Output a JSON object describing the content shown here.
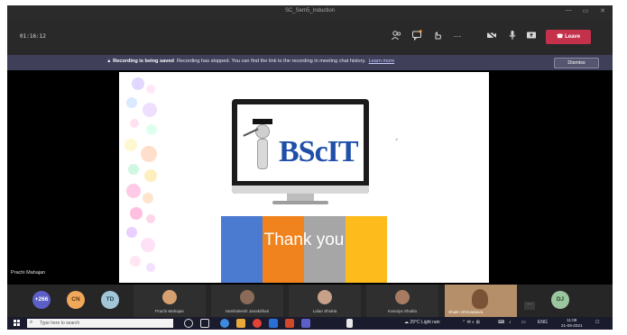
{
  "window": {
    "title": "SC_Sem5_Induction"
  },
  "toolbar": {
    "timer": "01:16:12",
    "icons": [
      "people-icon",
      "chat-icon",
      "reactions-icon",
      "more-icon",
      "camera-icon",
      "mic-icon",
      "share-icon"
    ],
    "leave_label": "Leave",
    "leave_color": "#c4314b"
  },
  "banner": {
    "bold": "Recording is being saved",
    "text": "Recording has stopped. You can find the link to the recording in meeting chat history.",
    "link": "Learn more",
    "dismiss": "Dismiss"
  },
  "stage": {
    "presenter_name": "Prachi Mahajan"
  },
  "slide": {
    "logo_text": "BScIT",
    "thank_you": "Thank you",
    "strip_colors": [
      "#4a7bd0",
      "#f0831e",
      "#a6a6a6",
      "#fdbb1c"
    ]
  },
  "gallery": {
    "overflow": "+266",
    "initials": [
      {
        "text": "CN",
        "color": "#f0a85a"
      },
      {
        "text": "TD",
        "color": "#a2c6d8"
      },
      {
        "text": "DJ",
        "color": "#9cc6a0"
      }
    ],
    "participants": [
      {
        "name": "Prachi Mahajan",
        "avatar_color": "#d6a070"
      },
      {
        "name": "Harshdeesh Janakdhari",
        "avatar_color": "#8a6b57"
      },
      {
        "name": "Lalan Shukla",
        "avatar_color": "#c7a08a"
      },
      {
        "name": "Kanaiya Shukla",
        "avatar_color": "#a77a62"
      }
    ],
    "video_name": "Shalin Shrivastava"
  },
  "taskbar": {
    "search_placeholder": "Type here to search",
    "weather": "29°C Light rain",
    "lang": "ENG",
    "time": "11:08",
    "date": "21-09-2021"
  }
}
